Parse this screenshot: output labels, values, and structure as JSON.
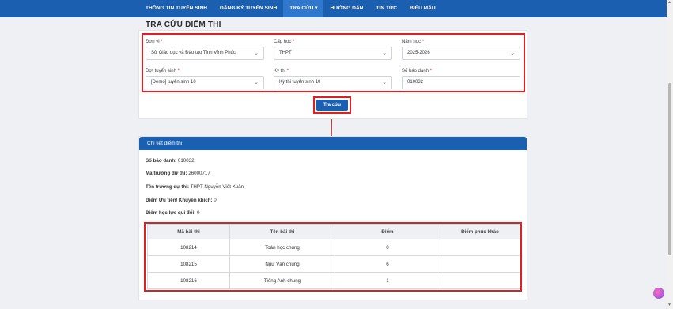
{
  "nav": {
    "items": [
      {
        "label": "THÔNG TIN TUYỂN SINH",
        "active": false
      },
      {
        "label": "ĐĂNG KÝ TUYỂN SINH",
        "active": false
      },
      {
        "label": "TRA CỨU ▾",
        "active": true
      },
      {
        "label": "HƯỚNG DẪN",
        "active": false
      },
      {
        "label": "TIN TỨC",
        "active": false
      },
      {
        "label": "BIỂU MẪU",
        "active": false
      }
    ]
  },
  "page_title": "TRA CỨU ĐIỂM THI",
  "form": {
    "don_vi": {
      "label": "Đơn vị",
      "value": "Sở Giáo dục và Đào tạo Tỉnh Vĩnh Phúc"
    },
    "cap_hoc": {
      "label": "Cấp học",
      "value": "THPT"
    },
    "nam_hoc": {
      "label": "Năm học",
      "value": "2025-2026"
    },
    "dot_tuyen_sinh": {
      "label": "Đợt tuyển sinh",
      "value": "[Demo] tuyển sinh 10"
    },
    "ky_thi": {
      "label": "Kỳ thi",
      "value": "Kỳ thi tuyển sinh 10"
    },
    "so_bao_danh": {
      "label": "Số báo danh",
      "value": "010032"
    },
    "required_mark": "*",
    "submit_label": "Tra cứu"
  },
  "details": {
    "header": "Chi tiết điểm thi",
    "fields": [
      {
        "label": "Số báo danh:",
        "value": "010032"
      },
      {
        "label": "Mã trường dự thi:",
        "value": "26000717"
      },
      {
        "label": "Tên trường dự thi:",
        "value": "THPT Nguyễn Viết Xuân"
      },
      {
        "label": "Điểm Ưu tiên/ Khuyến khích:",
        "value": "0"
      },
      {
        "label": "Điểm học lực qui đổi:",
        "value": "0"
      }
    ],
    "table": {
      "headers": [
        "Mã bài thi",
        "Tên bài thi",
        "Điểm",
        "Điểm phúc khảo"
      ],
      "rows": [
        [
          "108214",
          "Toán học chung",
          "0",
          ""
        ],
        [
          "108215",
          "Ngữ Văn chung",
          "6",
          ""
        ],
        [
          "108216",
          "Tiếng Anh chung",
          "1",
          ""
        ]
      ]
    }
  },
  "colors": {
    "primary": "#1b5fb1",
    "highlight": "#e02020"
  }
}
